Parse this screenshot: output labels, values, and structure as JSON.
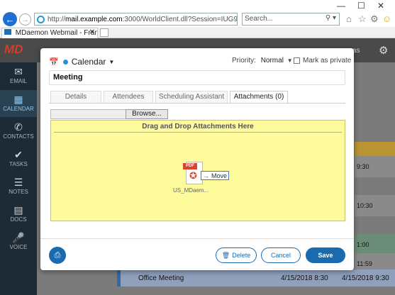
{
  "browser": {
    "url": "http://mail.example.com:3000/WorldClient.dll?Session=IUG9Y05C",
    "url_host": "mail.example.com",
    "url_prefix": "http://",
    "url_suffix": ":3000/WorldClient.dll?Session=IUG9Y05C",
    "search_placeholder": "Search...",
    "tab_title": "MDaemon Webmail - Frank...",
    "window_controls": [
      "—",
      "☐",
      "✕"
    ]
  },
  "app": {
    "logo": "MD",
    "sidebar": [
      {
        "icon": "envelope-icon",
        "label": "EMAIL"
      },
      {
        "icon": "calendar-icon",
        "label": "CALENDAR",
        "active": true
      },
      {
        "icon": "phone-icon",
        "label": "CONTACTS"
      },
      {
        "icon": "check-icon",
        "label": "TASKS"
      },
      {
        "icon": "notes-icon",
        "label": "NOTES"
      },
      {
        "icon": "document-icon",
        "label": "DOCS"
      },
      {
        "icon": "microphone-icon",
        "label": "VOICE"
      }
    ],
    "background_times": [
      "9:30",
      "10:30",
      "1:00",
      "11:59"
    ],
    "background_event": {
      "title": "Office Meeting",
      "start": "4/15/2018 8:30",
      "end": "4/15/2018 9:30"
    },
    "header_fragment": "as"
  },
  "modal": {
    "calendar_label": "Calendar",
    "priority_label": "Priority:",
    "priority_value": "Normal",
    "private_label": "Mark as private",
    "subject": "Meeting",
    "tabs": [
      "Details",
      "Attendees",
      "Scheduling Assistant",
      "Attachments (0)"
    ],
    "active_tab": 3,
    "browse_label": "Browse...",
    "drop_title": "Drag and Drop Attachments Here",
    "drag_file_name": "US_MDaem...",
    "drag_file_type": "PDF",
    "drag_hint": "Move",
    "delete_label": "Delete",
    "cancel_label": "Cancel",
    "save_label": "Save"
  },
  "colors": {
    "accent": "#1a6aae",
    "calendar_dot": "#2b8fd6",
    "drop_zone": "#fdfb9c",
    "pdf_red": "#d9442c"
  }
}
